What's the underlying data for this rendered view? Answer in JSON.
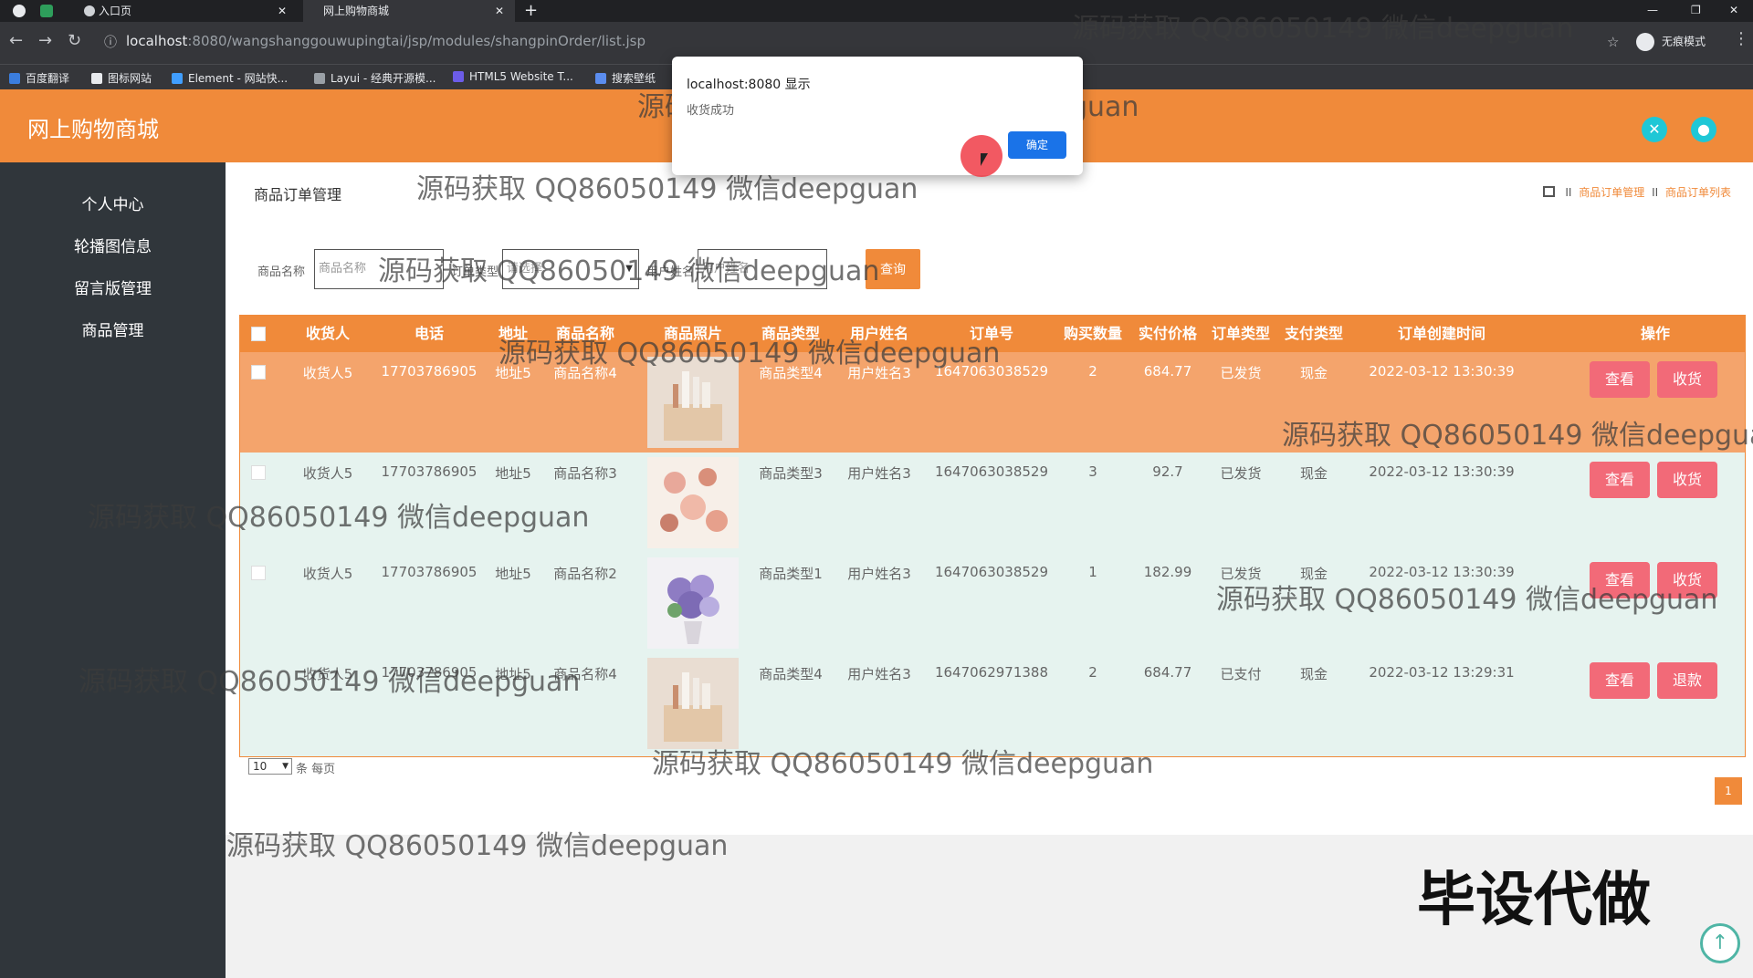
{
  "browser": {
    "tabs": [
      {
        "label": "入口页"
      },
      {
        "label": "网上购物商城"
      }
    ],
    "url_host": "localhost",
    "url_path": ":8080/wangshanggouwupingtai/jsp/modules/shangpinOrder/list.jsp",
    "incognito_label": "无痕模式",
    "bookmarks": [
      "百度翻译",
      "图标网站",
      "Element - 网站快...",
      "Layui - 经典开源模...",
      "HTML5 Website T...",
      "搜索壁纸"
    ]
  },
  "header": {
    "title": "网上购物商城"
  },
  "sidebar": {
    "items": [
      {
        "label": "个人中心"
      },
      {
        "label": "轮播图信息"
      },
      {
        "label": "留言版管理"
      },
      {
        "label": "商品管理"
      }
    ]
  },
  "page": {
    "title": "商品订单管理",
    "breadcrumb": [
      "商品订单管理",
      "商品订单列表"
    ],
    "breadcrumb_sep": "II"
  },
  "search": {
    "fields": [
      {
        "label": "商品名称",
        "placeholder": "商品名称"
      },
      {
        "label": "订单类型",
        "placeholder": "请选择"
      },
      {
        "label": "用户姓名",
        "placeholder": "用户姓名"
      }
    ],
    "button": "查询"
  },
  "table": {
    "columns": [
      "收货人",
      "电话",
      "地址",
      "商品名称",
      "商品照片",
      "商品类型",
      "用户姓名",
      "订单号",
      "购买数量",
      "实付价格",
      "订单类型",
      "支付类型",
      "订单创建时间",
      "操作"
    ],
    "rows": [
      {
        "receiver": "收货人5",
        "phone": "17703786905",
        "address": "地址5",
        "product": "商品名称4",
        "type": "商品类型4",
        "user": "用户姓名3",
        "order_no": "1647063038529",
        "qty": "2",
        "price": "684.77",
        "order_type": "已发货",
        "pay_type": "现金",
        "created": "2022-03-12 13:30:39",
        "action1": "查看",
        "action2": "收货"
      },
      {
        "receiver": "收货人5",
        "phone": "17703786905",
        "address": "地址5",
        "product": "商品名称3",
        "type": "商品类型3",
        "user": "用户姓名3",
        "order_no": "1647063038529",
        "qty": "3",
        "price": "92.7",
        "order_type": "已发货",
        "pay_type": "现金",
        "created": "2022-03-12 13:30:39",
        "action1": "查看",
        "action2": "收货"
      },
      {
        "receiver": "收货人5",
        "phone": "17703786905",
        "address": "地址5",
        "product": "商品名称2",
        "type": "商品类型1",
        "user": "用户姓名3",
        "order_no": "1647063038529",
        "qty": "1",
        "price": "182.99",
        "order_type": "已发货",
        "pay_type": "现金",
        "created": "2022-03-12 13:30:39",
        "action1": "查看",
        "action2": "收货"
      },
      {
        "receiver": "收货人5",
        "phone": "17703786905",
        "address": "地址5",
        "product": "商品名称4",
        "type": "商品类型4",
        "user": "用户姓名3",
        "order_no": "1647062971388",
        "qty": "2",
        "price": "684.77",
        "order_type": "已支付",
        "pay_type": "现金",
        "created": "2022-03-12 13:29:31",
        "action1": "查看",
        "action2": "退款"
      }
    ]
  },
  "pagination": {
    "page_size": "10",
    "page_size_label": "条 每页",
    "current_page": "1"
  },
  "dialog": {
    "title": "localhost:8080 显示",
    "message": "收货成功",
    "ok": "确定"
  },
  "watermark": "源码获取 QQ86050149 微信deepguan",
  "stamp": "毕设代做",
  "colors": {
    "accent": "#f08a3a",
    "sidebar": "#30363b",
    "row_bg": "#e6f3ef",
    "row_highlight": "#f4a46c",
    "action_button": "#f26a78"
  }
}
